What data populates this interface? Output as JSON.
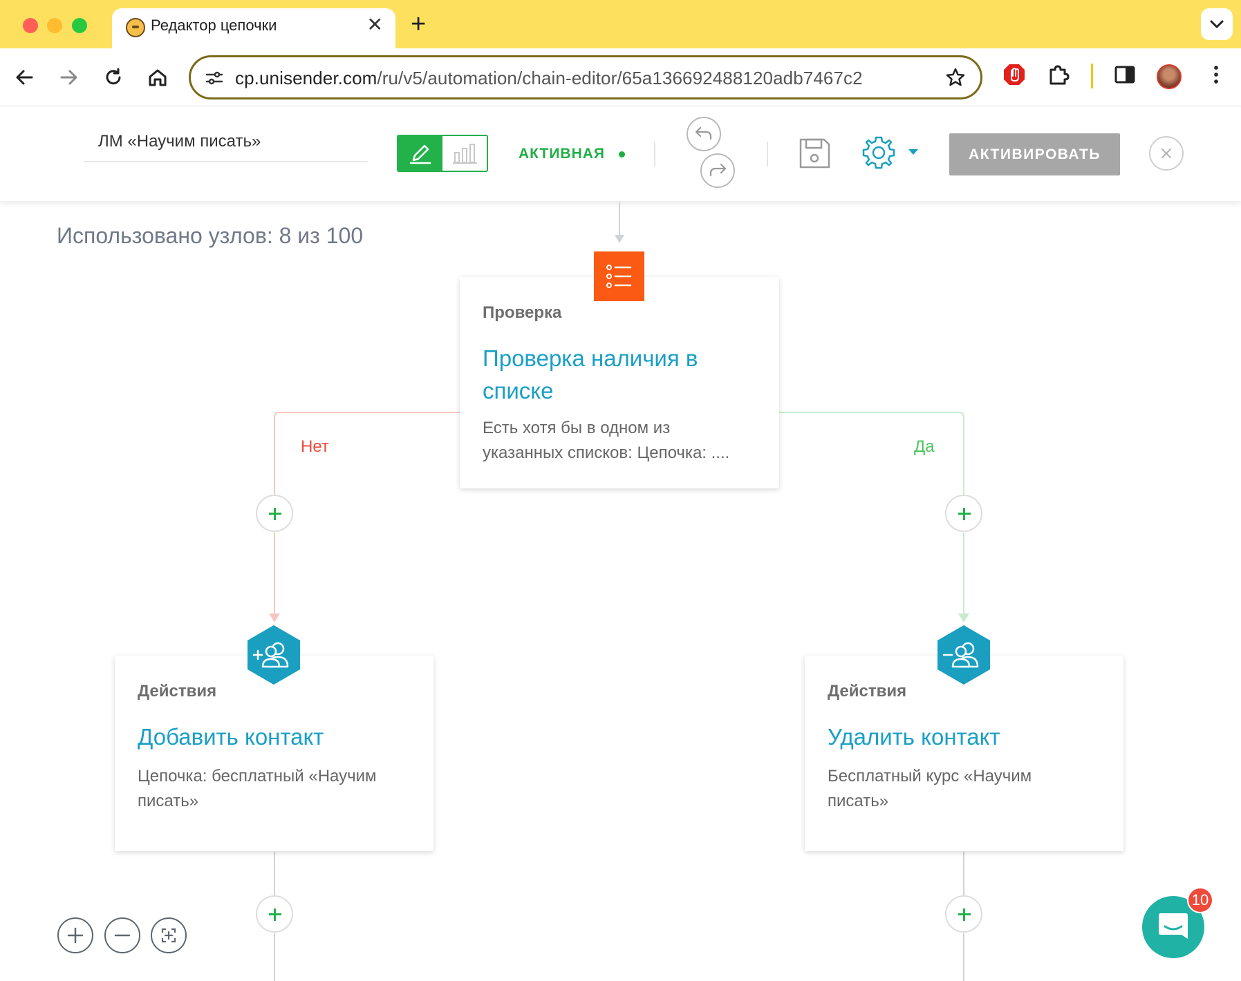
{
  "browser": {
    "tab_title": "Редактор цепочки",
    "tab_close": "✕",
    "new_tab": "+",
    "url_domain": "cp.unisender.com",
    "url_path": "/ru/v5/automation/chain-editor/65a136692488120adb7467c2"
  },
  "header": {
    "chain_name": "ЛМ «Научим писать»",
    "status": "АКТИВНАЯ",
    "activate_label": "АКТИВИРОВАТЬ"
  },
  "canvas": {
    "nodes_used": "Использовано узлов: 8 из 100",
    "branch_no": "Нет",
    "branch_yes": "Да",
    "check_node": {
      "type": "Проверка",
      "title_line1": "Проверка наличия в",
      "title_line2": "списке",
      "desc_line1": "Есть хотя бы в одном из",
      "desc_line2": "указанных списков: Цепочка: ...."
    },
    "left_node": {
      "type": "Действия",
      "title": "Добавить контакт",
      "desc_line1": "Цепочка: бесплатный «Научим",
      "desc_line2": "писать»"
    },
    "right_node": {
      "type": "Действия",
      "title": "Удалить контакт",
      "desc_line1": "Бесплатный курс «Научим",
      "desc_line2": "писать»"
    }
  },
  "chat": {
    "badge_count": "10"
  },
  "colors": {
    "tabbar": "#fde15e",
    "accent_green": "#23b14a",
    "link_blue": "#199fc7",
    "check_orange": "#fa5a14",
    "action_teal": "#1a9fc0",
    "no_red": "#f04a3a",
    "yes_green": "#4cc45e"
  },
  "icons": [
    "back-icon",
    "forward-icon",
    "reload-icon",
    "home-icon",
    "site-settings-icon",
    "star-icon",
    "adblock-icon",
    "extensions-icon",
    "sidepanel-icon",
    "menu-icon",
    "pencil-icon",
    "bar-chart-icon",
    "undo-icon",
    "redo-icon",
    "save-icon",
    "gear-icon",
    "caret-down-icon",
    "close-icon",
    "list-check-icon",
    "add-contact-icon",
    "remove-contact-icon",
    "zoom-in-icon",
    "zoom-out-icon",
    "fit-icon",
    "chat-icon"
  ]
}
